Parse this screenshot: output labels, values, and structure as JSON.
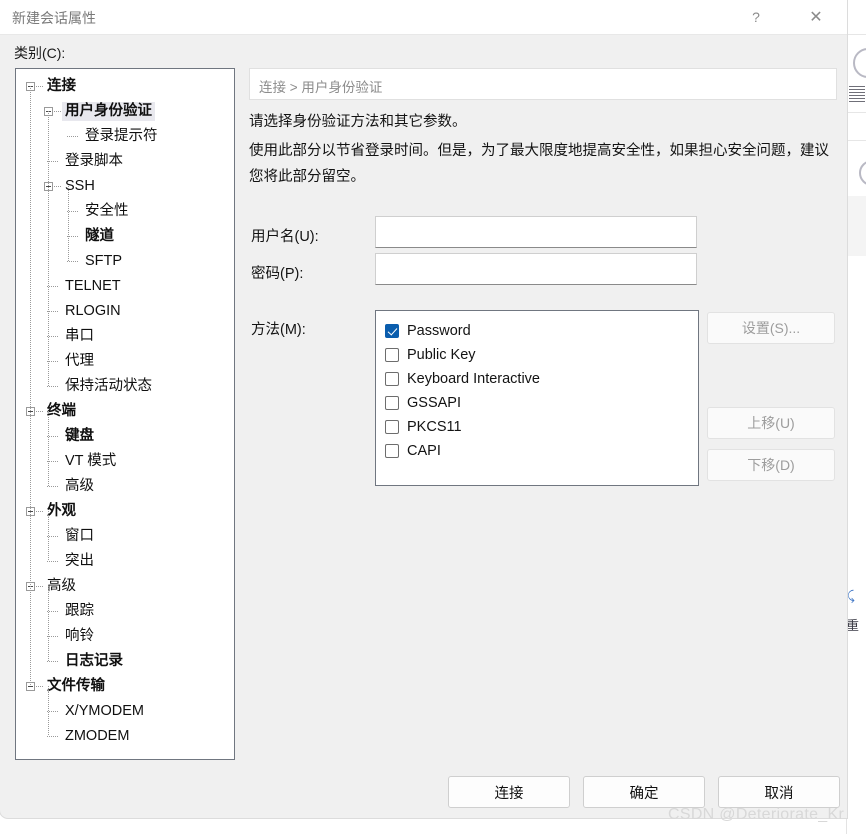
{
  "window": {
    "title": "新建会话属性",
    "help_label": "?",
    "close_label": "✕"
  },
  "category": {
    "label": "类别(C):",
    "tree": [
      {
        "label": "连接",
        "level": 0,
        "bold": true,
        "expander": true,
        "selected": false
      },
      {
        "label": "用户身份验证",
        "level": 1,
        "bold": true,
        "expander": true,
        "selected": true
      },
      {
        "label": "登录提示符",
        "level": 2,
        "bold": false,
        "expander": false,
        "selected": false
      },
      {
        "label": "登录脚本",
        "level": 1,
        "bold": false,
        "expander": false,
        "selected": false
      },
      {
        "label": "SSH",
        "level": 1,
        "bold": false,
        "expander": true,
        "selected": false
      },
      {
        "label": "安全性",
        "level": 2,
        "bold": false,
        "expander": false,
        "selected": false
      },
      {
        "label": "隧道",
        "level": 2,
        "bold": true,
        "expander": false,
        "selected": false
      },
      {
        "label": "SFTP",
        "level": 2,
        "bold": false,
        "expander": false,
        "selected": false
      },
      {
        "label": "TELNET",
        "level": 1,
        "bold": false,
        "expander": false,
        "selected": false
      },
      {
        "label": "RLOGIN",
        "level": 1,
        "bold": false,
        "expander": false,
        "selected": false
      },
      {
        "label": "串口",
        "level": 1,
        "bold": false,
        "expander": false,
        "selected": false
      },
      {
        "label": "代理",
        "level": 1,
        "bold": false,
        "expander": false,
        "selected": false
      },
      {
        "label": "保持活动状态",
        "level": 1,
        "bold": false,
        "expander": false,
        "selected": false
      },
      {
        "label": "终端",
        "level": 0,
        "bold": true,
        "expander": true,
        "selected": false
      },
      {
        "label": "键盘",
        "level": 1,
        "bold": true,
        "expander": false,
        "selected": false
      },
      {
        "label": "VT 模式",
        "level": 1,
        "bold": false,
        "expander": false,
        "selected": false
      },
      {
        "label": "高级",
        "level": 1,
        "bold": false,
        "expander": false,
        "selected": false
      },
      {
        "label": "外观",
        "level": 0,
        "bold": true,
        "expander": true,
        "selected": false
      },
      {
        "label": "窗口",
        "level": 1,
        "bold": false,
        "expander": false,
        "selected": false
      },
      {
        "label": "突出",
        "level": 1,
        "bold": false,
        "expander": false,
        "selected": false
      },
      {
        "label": "高级",
        "level": 0,
        "bold": false,
        "expander": true,
        "selected": false
      },
      {
        "label": "跟踪",
        "level": 1,
        "bold": false,
        "expander": false,
        "selected": false
      },
      {
        "label": "响铃",
        "level": 1,
        "bold": false,
        "expander": false,
        "selected": false
      },
      {
        "label": "日志记录",
        "level": 1,
        "bold": true,
        "expander": false,
        "selected": false
      },
      {
        "label": "文件传输",
        "level": 0,
        "bold": true,
        "expander": true,
        "selected": false
      },
      {
        "label": "X/YMODEM",
        "level": 1,
        "bold": false,
        "expander": false,
        "selected": false
      },
      {
        "label": "ZMODEM",
        "level": 1,
        "bold": false,
        "expander": false,
        "selected": false
      }
    ]
  },
  "main": {
    "breadcrumb": "连接 > 用户身份验证",
    "description_line1": "请选择身份验证方法和其它参数。",
    "description_line2": "使用此部分以节省登录时间。但是，为了最大限度地提高安全性，如果担心安全问题，建议您将此部分留空。",
    "username": {
      "label": "用户名(U):",
      "value": "",
      "placeholder": ""
    },
    "password": {
      "label": "密码(P):",
      "value": "",
      "placeholder": ""
    },
    "method": {
      "label": "方法(M):",
      "items": [
        {
          "label": "Password",
          "checked": true
        },
        {
          "label": "Public Key",
          "checked": false
        },
        {
          "label": "Keyboard Interactive",
          "checked": false
        },
        {
          "label": "GSSAPI",
          "checked": false
        },
        {
          "label": "PKCS11",
          "checked": false
        },
        {
          "label": "CAPI",
          "checked": false
        }
      ]
    },
    "side_buttons": [
      {
        "label": "设置(S)...",
        "disabled": true,
        "name": "properties-button"
      },
      {
        "label": "上移(U)",
        "disabled": true,
        "name": "move-up-button"
      },
      {
        "label": "下移(D)",
        "disabled": true,
        "name": "move-down-button"
      }
    ]
  },
  "footer": {
    "buttons": [
      {
        "label": "连接",
        "name": "connect-button"
      },
      {
        "label": "确定",
        "name": "ok-button"
      },
      {
        "label": "取消",
        "name": "cancel-button"
      }
    ]
  },
  "watermark": "CSDN @Deteriorate_Kr",
  "colors": {
    "accent": "#0a5dad",
    "dialog_bg": "#f0f0f0",
    "panel_bg": "#ffffff",
    "selection": "#e8e8ee",
    "disabled_text": "#9d9d9d"
  }
}
